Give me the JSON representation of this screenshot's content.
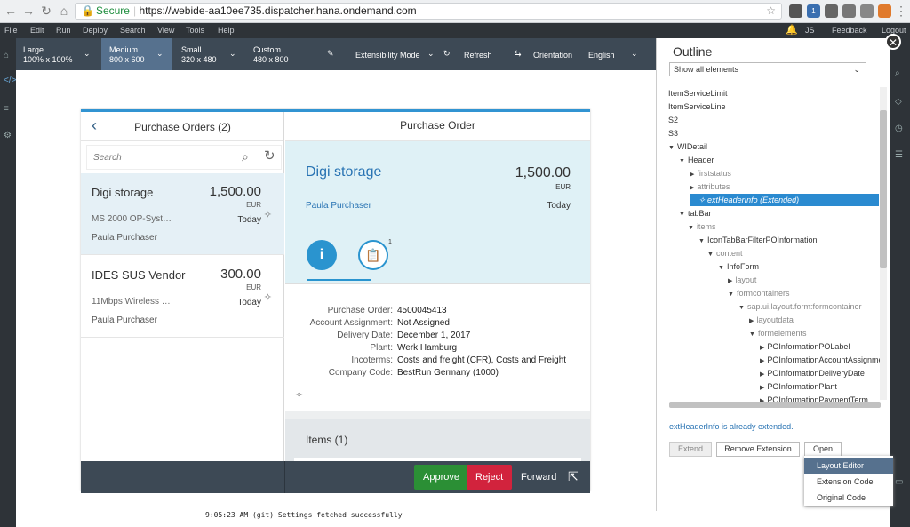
{
  "browser": {
    "secure_label": "Secure",
    "url_host": "https://webide-aa10ee735.dispatcher.hana.ondemand.com",
    "ext_badge": "1"
  },
  "menu": {
    "items": [
      "File",
      "Edit",
      "Run",
      "Deploy",
      "Search",
      "View",
      "Tools",
      "Help"
    ],
    "user": "JS",
    "feedback": "Feedback",
    "logout": "Logout"
  },
  "toolbar": {
    "large": {
      "label": "Large",
      "size": "100% x 100%"
    },
    "medium": {
      "label": "Medium",
      "size": "800 x 600"
    },
    "small": {
      "label": "Small",
      "size": "320 x 480"
    },
    "custom": {
      "label": "Custom",
      "size": "480 x 800"
    },
    "extensibility": "Extensibility Mode",
    "refresh": "Refresh",
    "orientation": "Orientation",
    "language": "English"
  },
  "master": {
    "title": "Purchase Orders (2)",
    "search_placeholder": "Search",
    "items": [
      {
        "title": "Digi storage",
        "number": "1,500.00",
        "currency": "EUR",
        "subtitle": "MS 2000 OP-Syst…",
        "status": "Today",
        "person": "Paula Purchaser"
      },
      {
        "title": "IDES SUS Vendor",
        "number": "300.00",
        "currency": "EUR",
        "subtitle": "11Mbps Wireless …",
        "status": "Today",
        "person": "Paula Purchaser"
      }
    ]
  },
  "detail": {
    "title": "Purchase Order",
    "object": {
      "title": "Digi storage",
      "number": "1,500.00",
      "currency": "EUR",
      "person": "Paula Purchaser",
      "date": "Today"
    },
    "tab_info_icon": "i",
    "notes_count": "1",
    "form": [
      {
        "label": "Purchase Order:",
        "value": "4500045413"
      },
      {
        "label": "Account Assignment:",
        "value": "Not Assigned"
      },
      {
        "label": "Delivery Date:",
        "value": "December 1, 2017"
      },
      {
        "label": "Plant:",
        "value": "Werk Hamburg"
      },
      {
        "label": "Incoterms:",
        "value": "Costs and freight (CFR), Costs and Freight"
      },
      {
        "label": "Company Code:",
        "value": "BestRun Germany (1000)"
      }
    ],
    "items_title": "Items (1)"
  },
  "footer": {
    "approve": "Approve",
    "reject": "Reject",
    "forward": "Forward"
  },
  "colors": {
    "approve": "#2b8f35",
    "reject": "#d2233d",
    "accent": "#2a94cf",
    "selection": "#2a8ad0"
  },
  "outline": {
    "title": "Outline",
    "filter": "Show all elements",
    "nodes": [
      {
        "label": "ItemServiceLimit",
        "tw": ""
      },
      {
        "label": "ItemServiceLine",
        "tw": ""
      },
      {
        "label": "S2",
        "tw": ""
      },
      {
        "label": "S3",
        "tw": ""
      },
      {
        "label": "WIDetail",
        "tw": "▼"
      },
      {
        "label": "Header",
        "tw": "▼"
      },
      {
        "label": "firststatus",
        "tw": "▶"
      },
      {
        "label": "attributes",
        "tw": "▶"
      },
      {
        "label": "extHeaderInfo (Extended)",
        "tw": ""
      },
      {
        "label": "tabBar",
        "tw": "▼"
      },
      {
        "label": "items",
        "tw": "▼"
      },
      {
        "label": "IconTabBarFilterPOInformation",
        "tw": "▼"
      },
      {
        "label": "content",
        "tw": "▼"
      },
      {
        "label": "InfoForm",
        "tw": "▼"
      },
      {
        "label": "layout",
        "tw": "▶"
      },
      {
        "label": "formcontainers",
        "tw": "▼"
      },
      {
        "label": "sap.ui.layout.form:formcontainer",
        "tw": "▼"
      },
      {
        "label": "layoutdata",
        "tw": "▶"
      },
      {
        "label": "formelements",
        "tw": "▼"
      },
      {
        "label": "POInformationPOLabel",
        "tw": "▶"
      },
      {
        "label": "POInformationAccountAssignme",
        "tw": "▶"
      },
      {
        "label": "POInformationDeliveryDate",
        "tw": "▶"
      },
      {
        "label": "POInformationPlant",
        "tw": "▶"
      },
      {
        "label": "POInformationPaymentTerm",
        "tw": "▶"
      }
    ],
    "status": "extHeaderInfo is already extended.",
    "extend": "Extend",
    "remove": "Remove Extension",
    "open": "Open",
    "open_menu": [
      "Layout Editor",
      "Extension Code",
      "Original Code"
    ]
  },
  "console": {
    "text": "9:05:23 AM (git) Settings fetched successfully"
  }
}
